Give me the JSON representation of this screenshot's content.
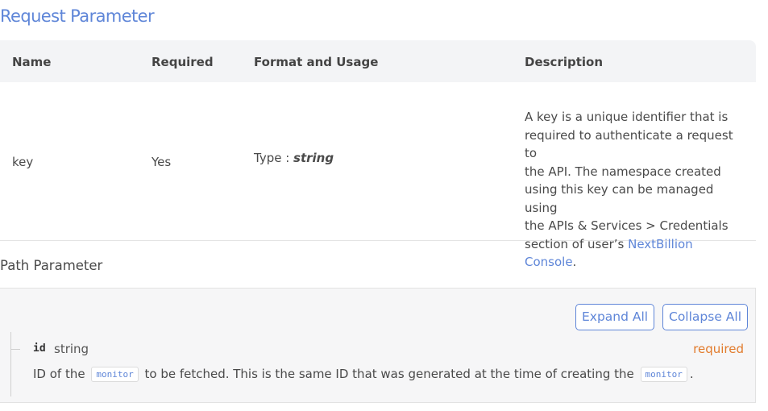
{
  "section_title": "Request Parameter",
  "table": {
    "headers": [
      "Name",
      "Required",
      "Format and Usage",
      "Description"
    ],
    "row": {
      "name": "key",
      "required": "Yes",
      "format_prefix": "Type : ",
      "format_type": "string",
      "description_lines": [
        "A key is a unique identifier that is",
        "required to authenticate a request to",
        "the API. The namespace created",
        "using this key can be managed using",
        "the APIs & Services > Credentials",
        "section of user’s "
      ],
      "description_link": "NextBillion Console",
      "description_end": "."
    }
  },
  "path_parameter": {
    "label": "Path Parameter",
    "expand_all": "Expand All",
    "collapse_all": "Collapse All",
    "param": {
      "name": "id",
      "type": "string",
      "required": "required",
      "desc_part1": "ID of the ",
      "code1": "monitor",
      "desc_part2": " to be fetched. This is the same ID that was generated at the time of creating the ",
      "code2": "monitor",
      "desc_part3": "."
    }
  },
  "colors": {
    "accent": "#5f86d8",
    "required": "#e27b2c",
    "header_bg": "#f3f4f6"
  }
}
